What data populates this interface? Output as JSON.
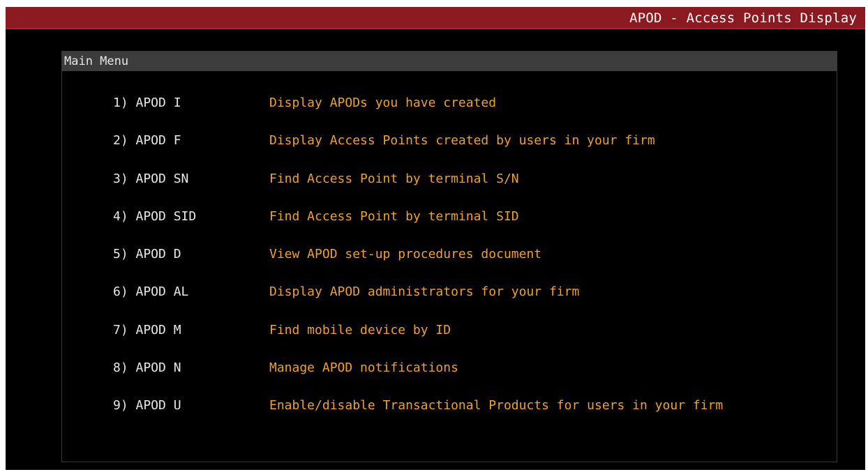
{
  "window": {
    "title": "APOD - Access Points Display"
  },
  "menu": {
    "header": "Main Menu",
    "items": [
      {
        "command": "1) APOD I",
        "description": "Display APODs you have created"
      },
      {
        "command": "2) APOD F",
        "description": "Display Access Points created by users in your firm"
      },
      {
        "command": "3) APOD SN",
        "description": "Find Access Point by terminal S/N"
      },
      {
        "command": "4) APOD SID",
        "description": "Find Access Point by terminal SID"
      },
      {
        "command": "5) APOD D",
        "description": "View APOD set-up procedures document"
      },
      {
        "command": "6) APOD AL",
        "description": "Display APOD administrators for your firm"
      },
      {
        "command": "7) APOD M",
        "description": "Find mobile device by ID"
      },
      {
        "command": "8) APOD N",
        "description": "Manage APOD notifications"
      },
      {
        "command": "9) APOD U",
        "description": "Enable/disable Transactional Products for users in your firm"
      }
    ]
  },
  "colors": {
    "title_bar": "#8b1a20",
    "background": "#000000",
    "command_text": "#e8e8e8",
    "description_text": "#f0a030",
    "panel_header": "#3c3c3c"
  }
}
